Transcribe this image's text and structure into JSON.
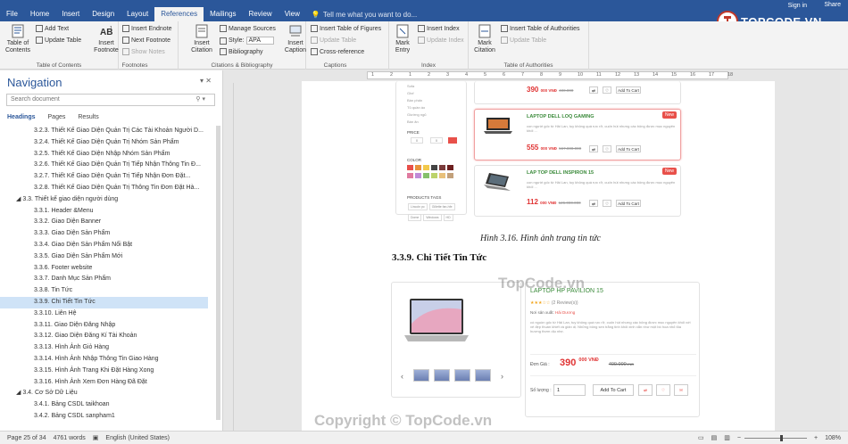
{
  "window": {
    "title": "",
    "signin": "Sign in",
    "share": "Share"
  },
  "tabs": [
    "File",
    "Home",
    "Insert",
    "Design",
    "Layout",
    "References",
    "Mailings",
    "Review",
    "View"
  ],
  "tell_me": "Tell me what you want to do...",
  "ribbon": {
    "toc": {
      "btn": "Table of Contents",
      "add_text": "Add Text",
      "update_table": "Update Table",
      "label": "Table of Contents"
    },
    "footnotes": {
      "insert_footnote": "Insert Footnote",
      "insert_endnote": "Insert Endnote",
      "next_footnote": "Next Footnote",
      "show_notes": "Show Notes",
      "label": "Footnotes"
    },
    "citations": {
      "insert_citation": "Insert Citation",
      "manage_sources": "Manage Sources",
      "style_label": "Style:",
      "style_value": "APA",
      "bibliography": "Bibliography",
      "label": "Citations & Bibliography"
    },
    "captions": {
      "insert_caption": "Insert Caption",
      "insert_tof": "Insert Table of Figures",
      "update_table": "Update Table",
      "cross_reference": "Cross-reference",
      "label": "Captions"
    },
    "index": {
      "mark_entry": "Mark Entry",
      "insert_index": "Insert Index",
      "update_index": "Update Index",
      "label": "Index"
    },
    "toa": {
      "mark_citation": "Mark Citation",
      "insert_toa": "Insert Table of Authorities",
      "update_table": "Update Table",
      "label": "Table of Authorities"
    }
  },
  "navigation": {
    "title": "Navigation",
    "search_placeholder": "Search document",
    "tabs": [
      "Headings",
      "Pages",
      "Results"
    ],
    "items": [
      {
        "text": "3.2.3. Thiết Kế Giao Diện Quản Trị Các Tài Khoản Người D...",
        "level": 3
      },
      {
        "text": "3.2.4. Thiết Kế Giao Diện Quản Trị Nhóm Sản Phẩm",
        "level": 3
      },
      {
        "text": "3.2.5. Thiết Kế Giao Diện Nhập Nhóm Sản Phẩm",
        "level": 3
      },
      {
        "text": "3.2.6. Thiết Kế Giao Diện Quản Trị Tiếp Nhận Thông Tin Đ...",
        "level": 3
      },
      {
        "text": "3.2.7. Thiết Kế Giao Diện Quản Trị Tiếp Nhận Đơn Đặt...",
        "level": 3
      },
      {
        "text": "3.2.8. Thiết Kế Giao Diện Quản Trị Thông Tin Đơn Đặt Hà...",
        "level": 3
      },
      {
        "text": "3.3. Thiết kế giao diện người dùng",
        "level": 2
      },
      {
        "text": "3.3.1. Header &Menu",
        "level": 3
      },
      {
        "text": "3.3.2. Giao Diện Banner",
        "level": 3
      },
      {
        "text": "3.3.3. Giao Diện Sản Phẩm",
        "level": 3
      },
      {
        "text": "3.3.4. Giao Diện Sản Phẩm Nổi Bật",
        "level": 3
      },
      {
        "text": "3.3.5. Giao Diện Sản Phẩm Mới",
        "level": 3
      },
      {
        "text": "3.3.6. Footer website",
        "level": 3
      },
      {
        "text": "3.3.7. Danh Mục Sản Phẩm",
        "level": 3
      },
      {
        "text": "3.3.8. Tin Tức",
        "level": 3
      },
      {
        "text": "3.3.9. Chi Tiết Tin Tức",
        "level": 3,
        "selected": true
      },
      {
        "text": "3.3.10. Liên Hệ",
        "level": 3
      },
      {
        "text": "3.3.11. Giao Diện Đăng Nhập",
        "level": 3
      },
      {
        "text": "3.3.12. Giao Diện Đăng Kí Tài Khoản",
        "level": 3
      },
      {
        "text": "3.3.13. Hình Ảnh Giỏ Hàng",
        "level": 3
      },
      {
        "text": "3.3.14. Hình Ảnh Nhập Thông Tin Giao Hàng",
        "level": 3
      },
      {
        "text": "3.3.15. Hình Ảnh Trang Khi Đặt Hàng Xong",
        "level": 3
      },
      {
        "text": "3.3.16. Hình Ảnh Xem Đơn Hàng Đã Đặt",
        "level": 3
      },
      {
        "text": "3.4. Cơ Sở Dữ Liệu",
        "level": 2
      },
      {
        "text": "3.4.1. Bảng CSDL taikhoan",
        "level": 3
      },
      {
        "text": "3.4.2. Bảng CSDL sanpham1",
        "level": 3
      }
    ]
  },
  "ruler_numbers": [
    "1",
    "2",
    "1",
    "2",
    "3",
    "4",
    "5",
    "6",
    "7",
    "8",
    "9",
    "10",
    "11",
    "12",
    "13",
    "14",
    "15",
    "16",
    "17",
    "18"
  ],
  "document": {
    "caption": "Hình 3.16. Hình ảnh trang tin tức",
    "heading": "3.3.9. Chi Tiết Tin Tức",
    "top_sidebar": {
      "filters": [
        "Sofa",
        "Ghế",
        "Bàn phấn",
        "Tủ quần áo",
        "Giường ngủ",
        "Bàn ăn"
      ],
      "price_label": "PRICE",
      "price_from": "0",
      "price_to": "0",
      "color_label": "COLOR",
      "colors": [
        "#e8504a",
        "#e8923c",
        "#f2c94c",
        "#444444",
        "#7a3b3b",
        "#6d1f1f",
        "#e07aa0",
        "#c08bd8",
        "#86c06c",
        "#bcd36b",
        "#e8c07a",
        "#c2a07a"
      ],
      "tags_label": "PRODUCTS TAGS",
      "tags": [
        "Lincoln pc",
        "Gillette fan-hfe",
        "Dome",
        "Windows",
        "HD"
      ]
    },
    "top_products": [
      {
        "name": "",
        "price": "390",
        "currency": "000 VNĐ",
        "old": "400.000",
        "add": "Add To Cart",
        "desc": ""
      },
      {
        "name": "LAPTOP DELL LOQ GAMING",
        "price": "555",
        "currency": "000 VNĐ",
        "old": "567.000.000",
        "add": "Add To Cart",
        "badge": "New",
        "desc": "con người gốc từ Hải Lan, tuy không quá rực rỡ, cuốn hút nhưng các bông được mọc nguyên khối ..."
      },
      {
        "name": "LAP TOP DELL INSPIRON 15",
        "price": "112",
        "currency": "000 VNĐ",
        "old": "126.000.000",
        "add": "Add To Cart",
        "badge": "New",
        "desc": "con người gốc từ Hải Lan, tuy không quá rực rỡ, cuốn hút nhưng các bông được mọc nguyên khối ..."
      }
    ],
    "detail": {
      "name": "LAPTOP HP PAVILION 15",
      "reviews": "(2 Review(s))",
      "origin_label": "Nơi sản xuất:",
      "origin": "Hải Dương",
      "desc": "có nguồn gốc từ Hải Lan, tuy không quá rực rỡ, cuốn hút nhưng các bông được mọc nguyên khối với vẻ đẹp thuần khiết và giản dị. Những bông sen trắng tinh khôi xinh xắn như một bó hoa nhỏ tỏa hương thơm dịu nhẹ.",
      "price_label": "Đơn Giá :",
      "price": "390",
      "currency": "000 VNĐ",
      "old": "400.000",
      "old_currency": "VNĐ",
      "qty_label": "Số lượng :",
      "qty": "1",
      "add": "Add To Cart",
      "rating": 3
    }
  },
  "watermarks": {
    "top": "TopCode.vn",
    "bottom": "Copyright © TopCode.vn"
  },
  "logo": {
    "text": "TOPCODE.VN"
  },
  "status": {
    "page": "Page 25 of 34",
    "words": "4761 words",
    "language": "English (United States)",
    "zoom": "108%"
  }
}
